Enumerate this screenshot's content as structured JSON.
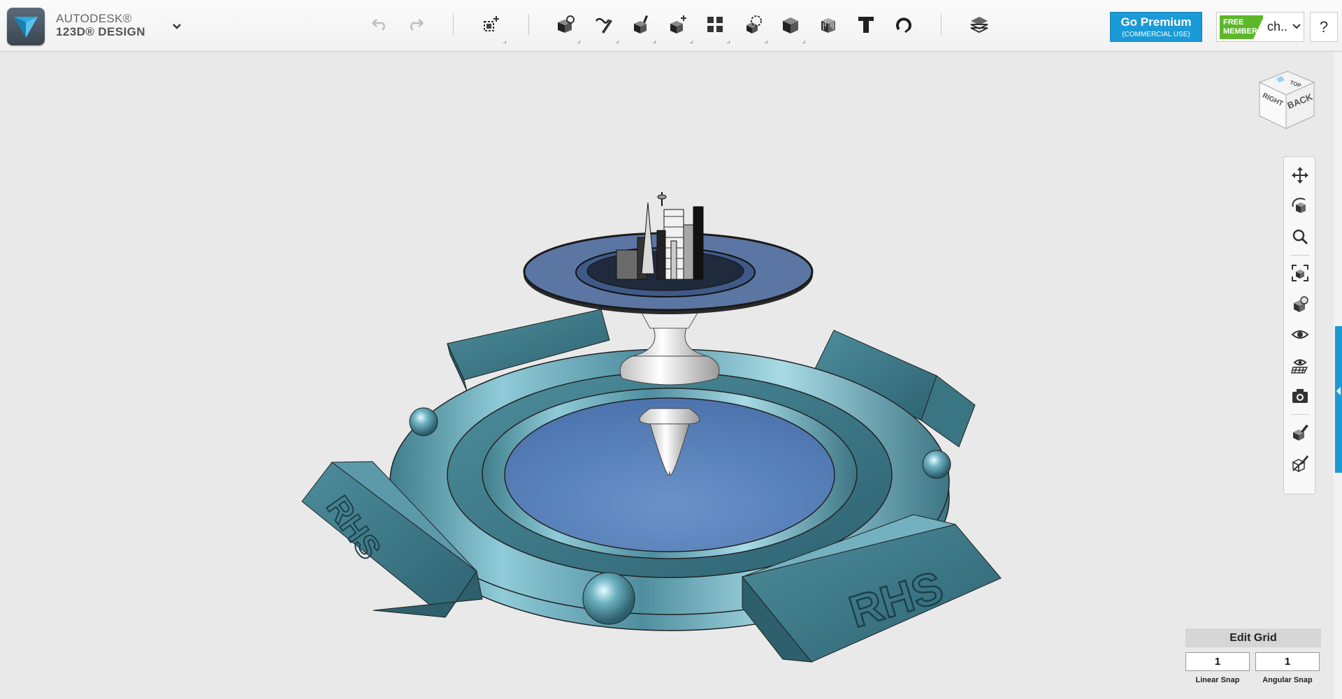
{
  "app": {
    "brand_line1": "AUTODESK®",
    "brand_line2": "123D® DESIGN",
    "brand_menu_icon": "chevron-down-icon"
  },
  "toolbar": {
    "undo_icon": "undo-icon",
    "redo_icon": "redo-icon",
    "tools": [
      {
        "name": "transform-tool",
        "icon": "add-transform-icon"
      },
      {
        "name": "primitives-tool",
        "icon": "primitives-icon"
      },
      {
        "name": "sketch-tool",
        "icon": "sketch-icon"
      },
      {
        "name": "construct-tool",
        "icon": "construct-icon"
      },
      {
        "name": "modify-tool",
        "icon": "modify-icon"
      },
      {
        "name": "pattern-tool",
        "icon": "pattern-icon"
      },
      {
        "name": "group-tool",
        "icon": "group-icon"
      },
      {
        "name": "combine-tool",
        "icon": "combine-icon"
      },
      {
        "name": "measure-tool",
        "icon": "measure-icon"
      },
      {
        "name": "text-tool",
        "icon": "text-icon"
      },
      {
        "name": "snap-tool",
        "icon": "snap-icon"
      },
      {
        "name": "materials-tool",
        "icon": "materials-icon"
      }
    ]
  },
  "account": {
    "premium_title": "Go Premium",
    "premium_sub": "(COMMERCIAL USE)",
    "badge_line1": "FREE",
    "badge_line2": "MEMBER",
    "user": "ch..",
    "help": "?"
  },
  "viewcube": {
    "top": "TOP",
    "right": "RIGHT",
    "back": "BACK"
  },
  "navbar": {
    "items": [
      "pan-icon",
      "orbit-icon",
      "zoom-icon",
      "fit-icon",
      "views-icon",
      "visibility-icon",
      "grid-visibility-icon",
      "screenshot-icon",
      "material-edit-icon",
      "wireframe-icon"
    ]
  },
  "scene": {
    "engraving": "RHS"
  },
  "grid": {
    "title": "Edit Grid",
    "linear_value": "1",
    "angular_value": "1",
    "linear_label": "Linear Snap",
    "angular_label": "Angular Snap"
  },
  "colors": {
    "accent": "#1a9ad6",
    "member_green": "#5cb82a",
    "model_metal": "#5a9fb0",
    "disc_blue": "#5f86bd"
  }
}
